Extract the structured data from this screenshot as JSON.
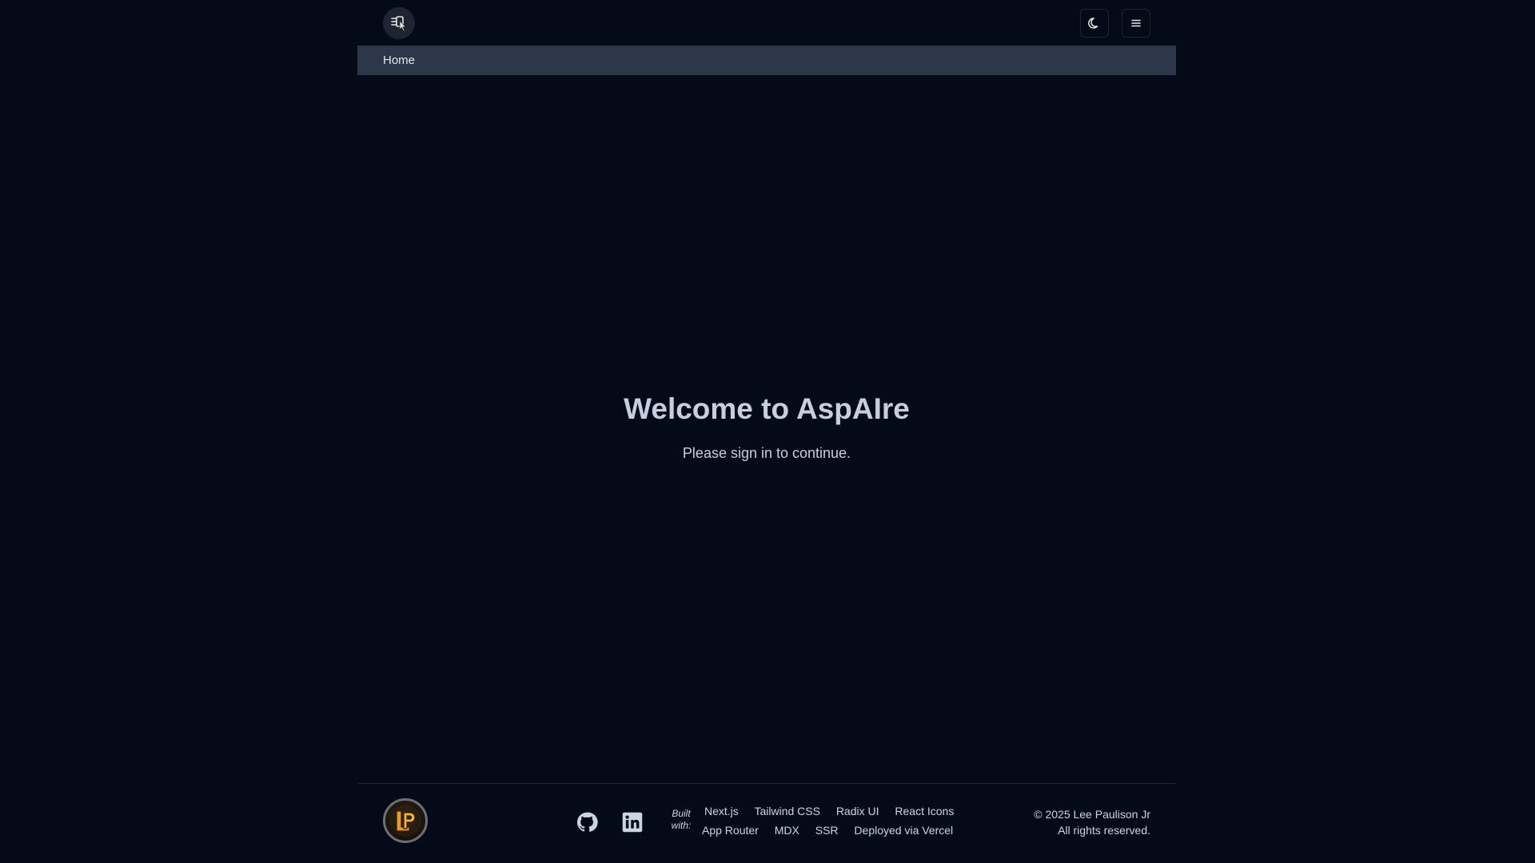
{
  "header": {
    "logo_icon": "dashboard-cursor-icon",
    "theme_icon": "moon-icon",
    "menu_icon": "hamburger-menu-icon"
  },
  "nav": {
    "home_label": "Home"
  },
  "hero": {
    "title": "Welcome to AspAIre",
    "subtitle": "Please sign in to continue."
  },
  "footer": {
    "logo_icon": "lp-monogram-logo",
    "github_icon": "github-icon",
    "linkedin_icon": "linkedin-icon",
    "built_with_line1": "Built",
    "built_with_line2": "with:",
    "tech_row1": [
      "Next.js",
      "Tailwind CSS",
      "Radix UI",
      "React Icons"
    ],
    "tech_row2": [
      "App Router",
      "MDX",
      "SSR",
      "Deployed via Vercel"
    ],
    "copyright_line1": "© 2025 Lee Paulison Jr",
    "copyright_line2": "All rights reserved."
  },
  "colors": {
    "background": "#050a17",
    "nav_bar": "#2c3749",
    "text": "#c6cfe0",
    "logo_accent": "#e69b2e"
  }
}
